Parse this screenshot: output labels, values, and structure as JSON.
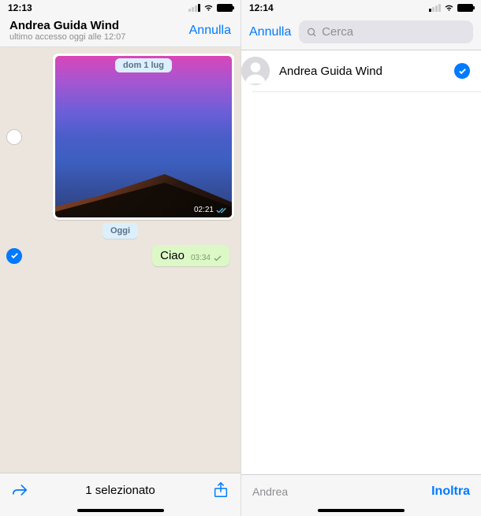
{
  "left": {
    "status": {
      "time": "12:13"
    },
    "header": {
      "title": "Andrea Guida Wind",
      "subtitle": "ultimo accesso oggi alle 12:07",
      "cancel": "Annulla"
    },
    "messages": {
      "image_date_pill": "dom 1 lug",
      "image_time": "02:21",
      "today_pill": "Oggi",
      "text_msg": "Ciao",
      "text_time": "03:34"
    },
    "footer": {
      "count_text": "1 selezionato"
    }
  },
  "right": {
    "status": {
      "time": "12:14"
    },
    "header": {
      "cancel": "Annulla",
      "search_placeholder": "Cerca"
    },
    "contact": {
      "name": "Andrea Guida Wind"
    },
    "footer": {
      "selected_name": "Andrea",
      "forward": "Inoltra"
    }
  }
}
